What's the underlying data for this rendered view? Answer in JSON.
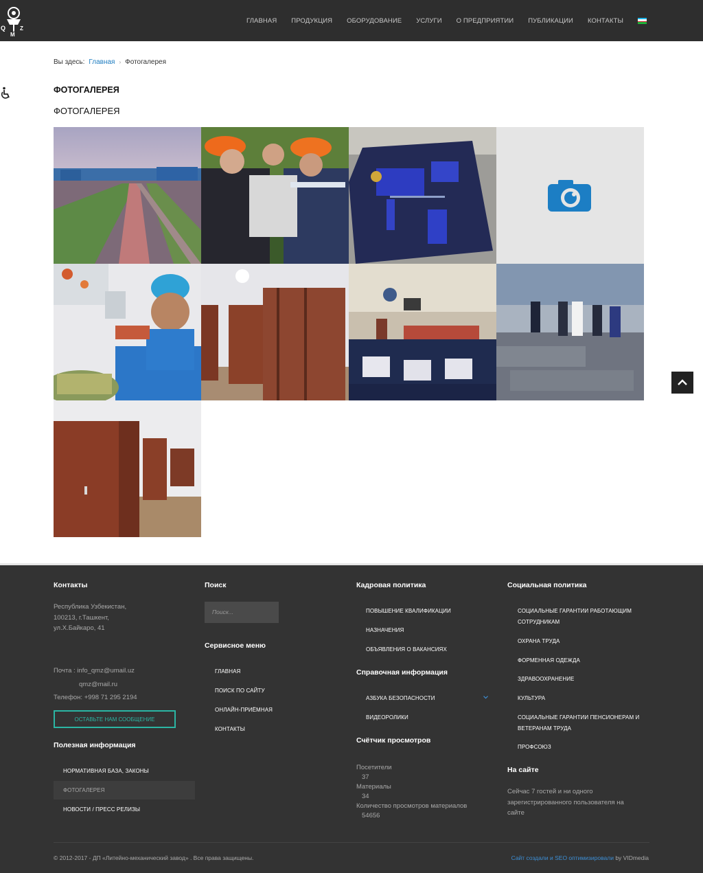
{
  "header": {
    "nav": [
      "ГЛАВНАЯ",
      "ПРОДУКЦИЯ",
      "ОБОРУДОВАНИЕ",
      "УСЛУГИ",
      "О ПРЕДПРИЯТИИ",
      "ПУБЛИКАЦИИ",
      "КОНТАКТЫ"
    ],
    "logo_letters": "QMZ",
    "flag_colors": [
      "#1eb5ea",
      "#ffffff",
      "#ce1126",
      "#ffffff",
      "#1eb53a"
    ]
  },
  "breadcrumb": {
    "prefix": "Вы здесь:",
    "home": "Главная",
    "separator": "›",
    "current": "Фотогалерея"
  },
  "page": {
    "title": "ФОТОГАЛЕРЕЯ",
    "subtitle": "ФОТОГАЛЕРЕЯ"
  },
  "gallery": {
    "photos": [
      {
        "subject": "factory-aerial"
      },
      {
        "subject": "workers-hardhats"
      },
      {
        "subject": "uniform-jacket"
      },
      {
        "subject": "placeholder-camera"
      },
      {
        "subject": "canteen-cook"
      },
      {
        "subject": "locker-room"
      },
      {
        "subject": "meeting-hall"
      },
      {
        "subject": "workshop-visit"
      },
      {
        "subject": "locker-room-2"
      }
    ]
  },
  "footer": {
    "contacts": {
      "heading": "Контакты",
      "address": [
        "Республика Узбекистан,",
        "100213, г.Ташкент,",
        "ул.Х.Байкаро, 41"
      ],
      "mail_label": "Почта : info_qmz@umail.uz",
      "mail_alt": "qmz@mail.ru",
      "phone": "Телефон: +998 71 295 2194",
      "message_button": "ОСТАВЬТЕ НАМ СООБЩЕНИЕ"
    },
    "useful": {
      "heading": "Полезная информация",
      "items": [
        "НОРМАТИВНАЯ БАЗА, ЗАКОНЫ",
        "ФОТОГАЛЕРЕЯ",
        "НОВОСТИ / ПРЕСС РЕЛИЗЫ"
      ]
    },
    "search": {
      "heading": "Поиск",
      "placeholder": "Поиск..."
    },
    "service": {
      "heading": "Сервисное меню",
      "items": [
        "ГЛАВНАЯ",
        "ПОИСК ПО САЙТУ",
        "ОНЛАЙН-ПРИЁМНАЯ",
        "КОНТАКТЫ"
      ]
    },
    "hr": {
      "heading": "Кадровая политика",
      "items": [
        "ПОВЫШЕНИЕ КВАЛИФИКАЦИИ",
        "НАЗНАЧЕНИЯ",
        "ОБЪЯВЛЕНИЯ О ВАКАНСИЯХ"
      ]
    },
    "reference": {
      "heading": "Справочная информация",
      "items": [
        "АЗБУКА БЕЗОПАСНОСТИ",
        "ВИДЕОРОЛИКИ"
      ]
    },
    "counter": {
      "heading": "Счётчик просмотров",
      "visitors_label": "Посетители",
      "visitors": "37",
      "materials_label": "Материалы",
      "materials": "34",
      "views_label": "Количество просмотров материалов",
      "views": "54656"
    },
    "social": {
      "heading": "Социальная политика",
      "items": [
        "СОЦИАЛЬНЫЕ ГАРАНТИИ РАБОТАЮЩИМ",
        "СОТРУДНИКАМ",
        "ОХРАНА ТРУДА",
        "ФОРМЕННАЯ ОДЕЖДА",
        "ЗДРАВООХРАНЕНИЕ",
        "КУЛЬТУРА",
        "СОЦИАЛЬНЫЕ ГАРАНТИИ ПЕНСИОНЕРАМ И",
        "ВЕТЕРАНАМ ТРУДА",
        "ПРОФСОЮЗ"
      ]
    },
    "online": {
      "heading": "На сайте",
      "text": [
        "Сейчас 7 гостей и ни одного",
        "зарегистрированного пользователя на",
        "сайте"
      ]
    },
    "copyright": "© 2012-2017 - ДП «Литейно-механический завод» . Все права защищены.",
    "credit_link": "Сайт создали и SEO оптимизировали",
    "credit_by": "by VIDmedia"
  }
}
